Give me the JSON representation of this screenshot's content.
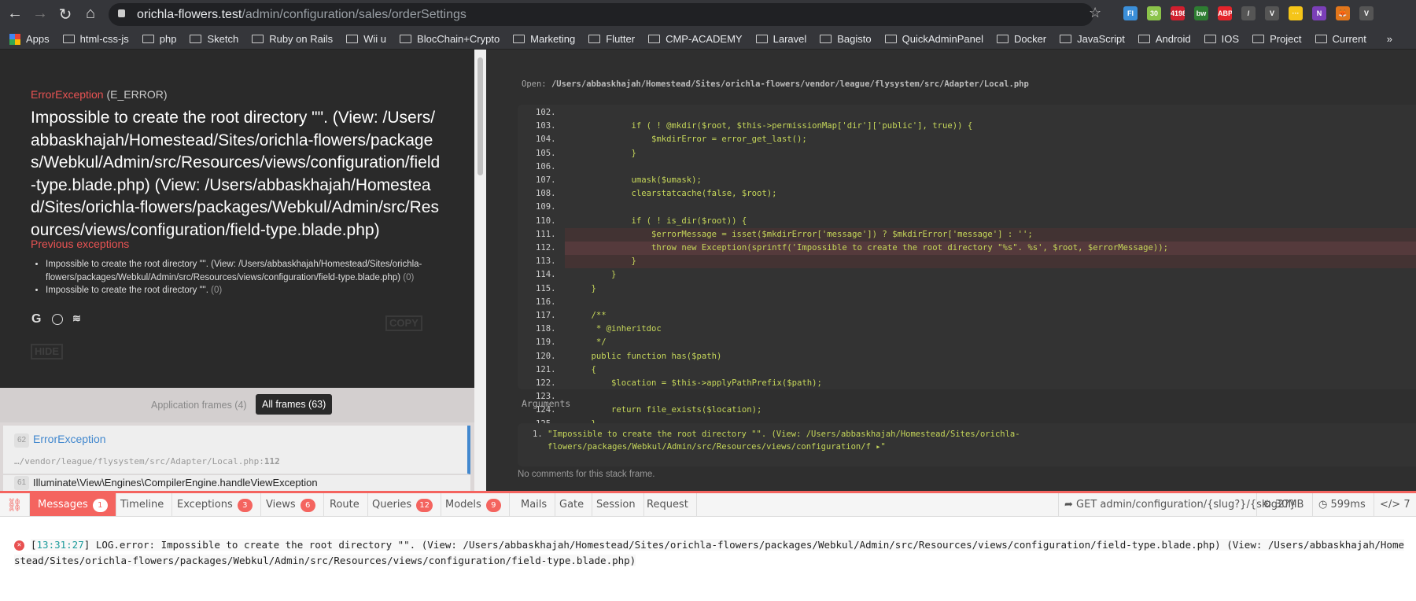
{
  "browser": {
    "url_host": "orichla-flowers.test",
    "url_path": "/admin/configuration/sales/orderSettings",
    "extensions": [
      {
        "label": "FI",
        "color": "#3b8fd9"
      },
      {
        "label": "30",
        "color": "#8bc34a"
      },
      {
        "label": "4198",
        "color": "#d01f2e"
      },
      {
        "label": "bw",
        "color": "#2e7d32"
      },
      {
        "label": "ABP",
        "color": "#e3242b"
      },
      {
        "label": "/",
        "color": "#555"
      },
      {
        "label": "V",
        "color": "#555"
      },
      {
        "label": "···",
        "color": "#f5c518"
      },
      {
        "label": "N",
        "color": "#7b3fb8"
      },
      {
        "label": "🦊",
        "color": "#e2761b"
      },
      {
        "label": "V",
        "color": "#555"
      }
    ],
    "bookmarks": [
      "Apps",
      "html-css-js",
      "php",
      "Sketch",
      "Ruby on Rails",
      "Wii u",
      "BlocChain+Crypto",
      "Marketing",
      "Flutter",
      "CMP-ACADEMY",
      "Laravel",
      "Bagisto",
      "QuickAdminPanel",
      "Docker",
      "JavaScript",
      "Android",
      "IOS",
      "Project",
      "Current"
    ],
    "more": "»"
  },
  "error": {
    "type": "ErrorException",
    "code": "(E_ERROR)",
    "message": "Impossible to create the root directory \"\". (View: /Users/abbaskhajah/Homestead/Sites/orichla-flowers/packages/Webkul/Admin/src/Resources/views/configuration/field-type.blade.php) (View: /Users/abbaskhajah/Homestead/Sites/orichla-flowers/packages/Webkul/Admin/src/Resources/views/configuration/field-type.blade.php)",
    "previous_title": "Previous exceptions",
    "previous": [
      {
        "text": "Impossible to create the root directory \"\". (View: /Users/abbaskhajah/Homestead/Sites/orichla-flowers/packages/Webkul/Admin/src/Resources/views/configuration/field-type.blade.php)",
        "count": "(0)"
      },
      {
        "text": "Impossible to create the root directory \"\".",
        "count": "(0)"
      }
    ],
    "copy_label": "COPY",
    "hide_label": "HIDE"
  },
  "frames": {
    "app_tab": "Application frames (4)",
    "all_tab": "All frames (63)",
    "items": [
      {
        "num": "62",
        "title": "ErrorException",
        "file": "…/vendor/league/flysystem/src/Adapter/Local.php",
        "line": "112"
      },
      {
        "num": "61",
        "title": "Illuminate\\View\\Engines\\CompilerEngine.handleViewException"
      }
    ]
  },
  "code": {
    "open_label": "Open:",
    "open_path": "/Users/abbaskhajah/Homestead/Sites/orichla-flowers/vendor/league/flysystem/src/Adapter/Local.php",
    "highlight_line": "112",
    "lines": [
      {
        "n": "102.",
        "t": ""
      },
      {
        "n": "103.",
        "t": "            if ( ! @mkdir($root, $this->permissionMap['dir']['public'], true)) {"
      },
      {
        "n": "104.",
        "t": "                $mkdirError = error_get_last();"
      },
      {
        "n": "105.",
        "t": "            }"
      },
      {
        "n": "106.",
        "t": ""
      },
      {
        "n": "107.",
        "t": "            umask($umask);"
      },
      {
        "n": "108.",
        "t": "            clearstatcache(false, $root);"
      },
      {
        "n": "109.",
        "t": ""
      },
      {
        "n": "110.",
        "t": "            if ( ! is_dir($root)) {"
      },
      {
        "n": "111.",
        "t": "                $errorMessage = isset($mkdirError['message']) ? $mkdirError['message'] : '';"
      },
      {
        "n": "112.",
        "t": "                throw new Exception(sprintf('Impossible to create the root directory \"%s\". %s', $root, $errorMessage));"
      },
      {
        "n": "113.",
        "t": "            }"
      },
      {
        "n": "114.",
        "t": "        }"
      },
      {
        "n": "115.",
        "t": "    }"
      },
      {
        "n": "116.",
        "t": ""
      },
      {
        "n": "117.",
        "t": "    /**"
      },
      {
        "n": "118.",
        "t": "     * @inheritdoc"
      },
      {
        "n": "119.",
        "t": "     */"
      },
      {
        "n": "120.",
        "t": "    public function has($path)"
      },
      {
        "n": "121.",
        "t": "    {"
      },
      {
        "n": "122.",
        "t": "        $location = $this->applyPathPrefix($path);"
      },
      {
        "n": "123.",
        "t": ""
      },
      {
        "n": "124.",
        "t": "        return file_exists($location);"
      },
      {
        "n": "125.",
        "t": "    }"
      }
    ],
    "arguments_title": "Arguments",
    "arguments": [
      "\"Impossible to create the root directory \"\".  (View: /Users/abbaskhajah/Homestead/Sites/orichla-flowers/packages/Webkul/Admin/src/Resources/views/configuration/f ▸\""
    ],
    "no_comments": "No comments for this stack frame."
  },
  "debugbar": {
    "accent": "#f4645f",
    "tabs": [
      {
        "label": "Messages",
        "badge": "1"
      },
      {
        "label": "Timeline"
      },
      {
        "label": "Exceptions",
        "badge": "3"
      },
      {
        "label": "Views",
        "badge": "6"
      },
      {
        "label": "Route"
      },
      {
        "label": "Queries",
        "badge": "12"
      },
      {
        "label": "Models",
        "badge": "9"
      },
      {
        "label": "Mails"
      },
      {
        "label": "Gate"
      },
      {
        "label": "Session"
      },
      {
        "label": "Request"
      }
    ],
    "route": "GET admin/configuration/{slug?}/{slug2?}",
    "memory": "30MB",
    "time": "599ms",
    "version": "7",
    "log": {
      "time": "13:31:27",
      "level": "LOG.error:",
      "message": "Impossible to create the root directory \"\".  (View: /Users/abbaskhajah/Homestead/Sites/orichla-flowers/packages/Webkul/Admin/src/Resources/views/configuration/field-type.blade.php) (View: /Users/abbaskhajah/Homestead/Sites/orichla-flowers/packages/Webkul/Admin/src/Resources/views/configuration/field-type.blade.php)"
    }
  }
}
